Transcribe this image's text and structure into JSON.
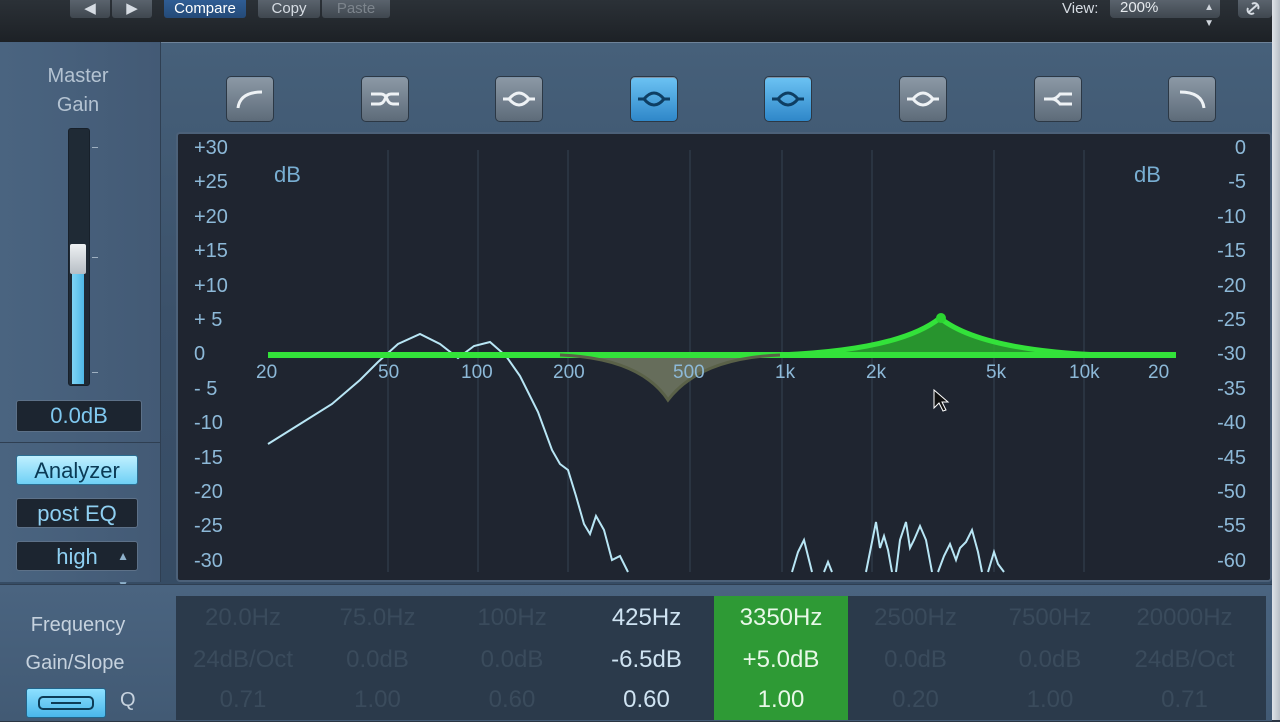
{
  "toolbar": {
    "compare": "Compare",
    "copy": "Copy",
    "paste": "Paste",
    "view_label": "View:",
    "view_value": "200%"
  },
  "left_panel": {
    "master_gain_line1": "Master",
    "master_gain_line2": "Gain",
    "gain_value": "0.0dB",
    "gain_level_fraction": 0.5,
    "analyzer": "Analyzer",
    "post_eq": "post EQ",
    "resolution": "high"
  },
  "bands": [
    {
      "icon": "low-cut-icon",
      "active": false
    },
    {
      "icon": "low-shelf-icon",
      "active": false
    },
    {
      "icon": "bell-icon",
      "active": false
    },
    {
      "icon": "bell-icon",
      "active": true
    },
    {
      "icon": "bell-icon",
      "active": true
    },
    {
      "icon": "bell-icon",
      "active": false
    },
    {
      "icon": "high-shelf-icon",
      "active": false
    },
    {
      "icon": "high-cut-icon",
      "active": false
    }
  ],
  "graph": {
    "db_left_title": "dB",
    "db_right_title": "dB",
    "left_scale": [
      "+30",
      "+25",
      "+20",
      "+15",
      "+10",
      "+ 5",
      "0",
      "- 5",
      "-10",
      "-15",
      "-20",
      "-25",
      "-30"
    ],
    "right_scale": [
      "0",
      "-5",
      "-10",
      "-15",
      "-20",
      "-25",
      "-30",
      "-35",
      "-40",
      "-45",
      "-50",
      "-55",
      "-60"
    ],
    "freq_labels": [
      "20",
      "50",
      "100",
      "200",
      "500",
      "1k",
      "2k",
      "5k",
      "10k",
      "20"
    ]
  },
  "params": {
    "row_labels": [
      "Frequency",
      "Gain/Slope",
      "Q"
    ],
    "columns": [
      {
        "freq": "20.0Hz",
        "gain": "24dB/Oct",
        "q": "0.71",
        "state": "off"
      },
      {
        "freq": "75.0Hz",
        "gain": "0.0dB",
        "q": "1.00",
        "state": "off"
      },
      {
        "freq": "100Hz",
        "gain": "0.0dB",
        "q": "0.60",
        "state": "off"
      },
      {
        "freq": "425Hz",
        "gain": "-6.5dB",
        "q": "0.60",
        "state": "on"
      },
      {
        "freq": "3350Hz",
        "gain": "+5.0dB",
        "q": "1.00",
        "state": "selected"
      },
      {
        "freq": "2500Hz",
        "gain": "0.0dB",
        "q": "0.20",
        "state": "off"
      },
      {
        "freq": "7500Hz",
        "gain": "0.0dB",
        "q": "1.00",
        "state": "off"
      },
      {
        "freq": "20000Hz",
        "gain": "24dB/Oct",
        "q": "0.71",
        "state": "off"
      }
    ]
  },
  "colors": {
    "eq_curve": "#33e23a",
    "analyzer_curve": "#b8e6f5",
    "selected_band": "#2e9a35",
    "active_button": "#4aa8e4"
  }
}
